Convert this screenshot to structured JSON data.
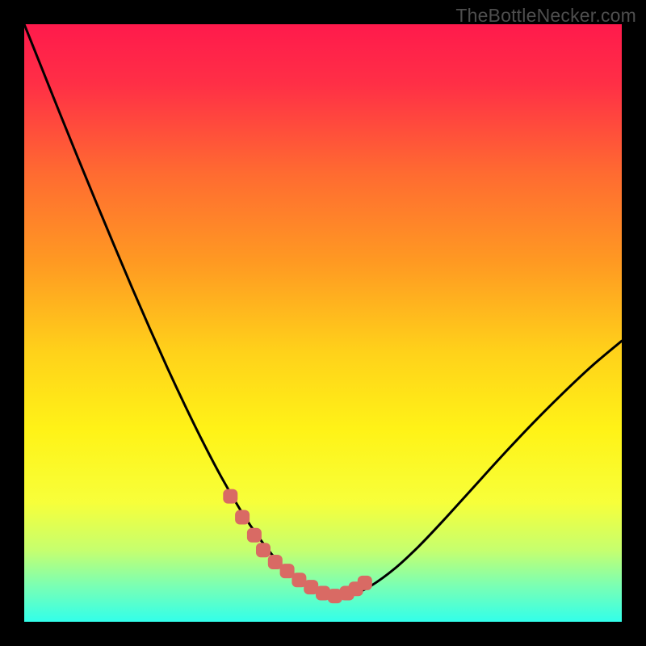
{
  "watermark": "TheBottleNecker.com",
  "colors": {
    "frame": "#000000",
    "curve": "#000000",
    "marker": "#d96a64",
    "gradient_stops": [
      {
        "offset": 0.0,
        "color": "#ff1a4c"
      },
      {
        "offset": 0.1,
        "color": "#ff2f46"
      },
      {
        "offset": 0.25,
        "color": "#ff6b31"
      },
      {
        "offset": 0.4,
        "color": "#ff9a22"
      },
      {
        "offset": 0.55,
        "color": "#ffd21a"
      },
      {
        "offset": 0.68,
        "color": "#fff317"
      },
      {
        "offset": 0.8,
        "color": "#f7ff3a"
      },
      {
        "offset": 0.88,
        "color": "#c6ff6e"
      },
      {
        "offset": 0.94,
        "color": "#7affb4"
      },
      {
        "offset": 1.0,
        "color": "#32ffea"
      }
    ]
  },
  "chart_data": {
    "type": "line",
    "title": "",
    "xlabel": "",
    "ylabel": "",
    "xlim": [
      0,
      100
    ],
    "ylim": [
      0,
      100
    ],
    "grid": false,
    "series": [
      {
        "name": "bottleneck-curve",
        "x": [
          0,
          3,
          6,
          9,
          12,
          15,
          18,
          21,
          24,
          27,
          30,
          33,
          36,
          38,
          40,
          42,
          44,
          46,
          48,
          50,
          52,
          55,
          58,
          62,
          66,
          70,
          75,
          80,
          85,
          90,
          95,
          100
        ],
        "y": [
          100,
          92.5,
          85.0,
          77.6,
          70.3,
          63.1,
          56.0,
          49.1,
          42.4,
          36.0,
          29.9,
          24.2,
          19.0,
          15.9,
          13.1,
          10.6,
          8.5,
          6.8,
          5.5,
          4.7,
          4.3,
          4.6,
          6.0,
          8.9,
          12.6,
          16.8,
          22.3,
          27.8,
          33.1,
          38.1,
          42.8,
          47.0
        ]
      }
    ],
    "markers": {
      "name": "highlighted-points",
      "x": [
        34.5,
        36.5,
        38.5,
        40,
        42,
        44,
        46,
        48,
        50,
        52,
        54,
        55.5,
        57
      ],
      "y": [
        21,
        17.5,
        14.5,
        12,
        10,
        8.5,
        7,
        5.8,
        4.8,
        4.3,
        4.8,
        5.5,
        6.5
      ]
    }
  }
}
